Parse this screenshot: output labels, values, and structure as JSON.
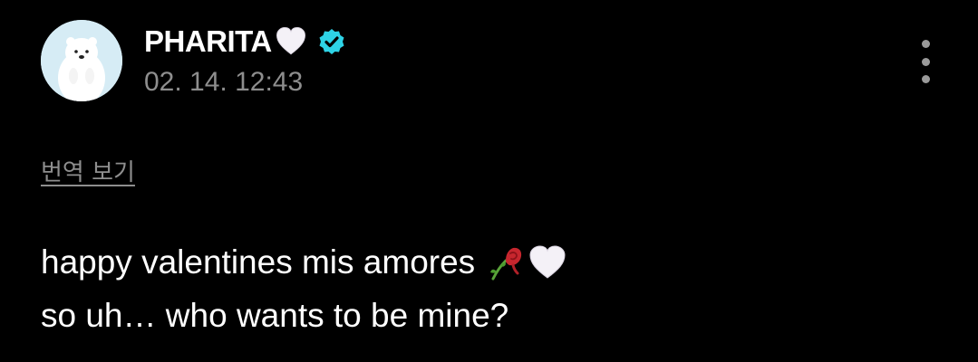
{
  "post": {
    "author": {
      "name": "PHARITA",
      "name_emoji": "white-heart-icon",
      "verified_icon": "verified-badge-icon",
      "avatar_icon": "polar-bear-avatar"
    },
    "timestamp": "02. 14. 12:43",
    "translate_label": "번역 보기",
    "more_icon": "more-vertical-icon",
    "body": {
      "line1": "happy valentines mis amores",
      "line1_emojis": [
        "wilted-rose-icon",
        "white-heart-icon"
      ],
      "line2": "so uh… who wants to be mine?"
    }
  },
  "colors": {
    "background": "#000000",
    "primary_text": "#ffffff",
    "secondary_text": "#8e8e8e",
    "verified": "#2ed3e6"
  }
}
